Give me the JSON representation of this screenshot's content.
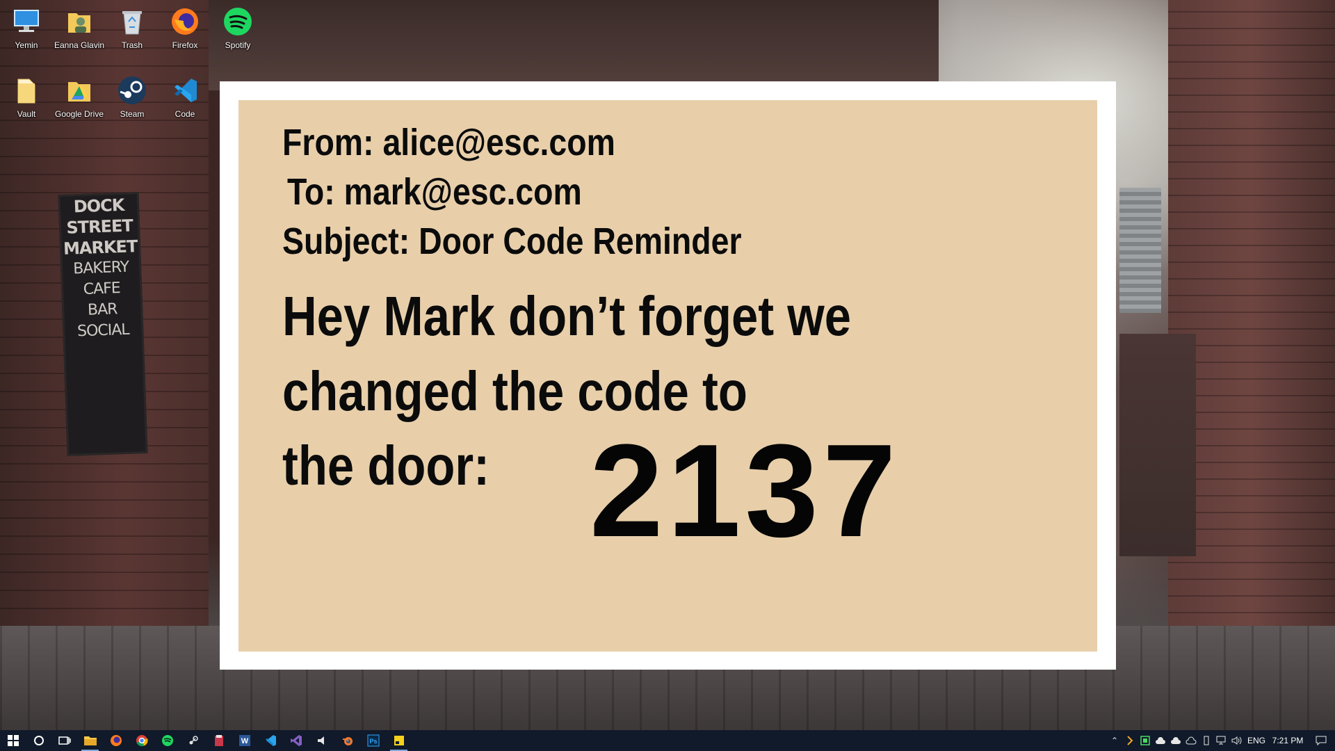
{
  "desktop": {
    "icons": [
      {
        "label": "Yemin",
        "icon": "computer-icon"
      },
      {
        "label": "Eanna Glavin",
        "icon": "user-folder-icon"
      },
      {
        "label": "Trash",
        "icon": "recycle-bin-icon"
      },
      {
        "label": "Firefox",
        "icon": "firefox-icon"
      },
      {
        "label": "Spotify",
        "icon": "spotify-icon"
      },
      {
        "label": "Vault",
        "icon": "folder-icon"
      },
      {
        "label": "Google Drive",
        "icon": "google-drive-icon"
      },
      {
        "label": "Steam",
        "icon": "steam-icon"
      },
      {
        "label": "Code",
        "icon": "vscode-icon"
      }
    ]
  },
  "wallpaper": {
    "sign_lines": [
      "DOCK",
      "STREET",
      "MARKET",
      "BAKERY",
      "CAFE",
      "BAR",
      "SOCIAL"
    ]
  },
  "email": {
    "from": "From: alice@esc.com",
    "to": "To: mark@esc.com",
    "subject": "Subject: Door Code Reminder",
    "body_line1": "Hey Mark don’t forget we",
    "body_line2": "changed the code to",
    "body_line3": "the door:",
    "code": "2137",
    "background_color": "#e8cfaa"
  },
  "taskbar": {
    "pinned": [
      "start-icon",
      "cortana-icon",
      "task-view-icon",
      "file-explorer-icon",
      "firefox-icon",
      "chrome-icon",
      "spotify-icon",
      "steam-icon",
      "archive-icon",
      "word-icon",
      "vscode-icon",
      "visual-studio-icon",
      "media-icon",
      "blender-icon",
      "photoshop-icon",
      "sticky-notes-icon"
    ],
    "language": "ENG",
    "time": "7:21 PM",
    "accent_color": "#7fa7d8"
  }
}
